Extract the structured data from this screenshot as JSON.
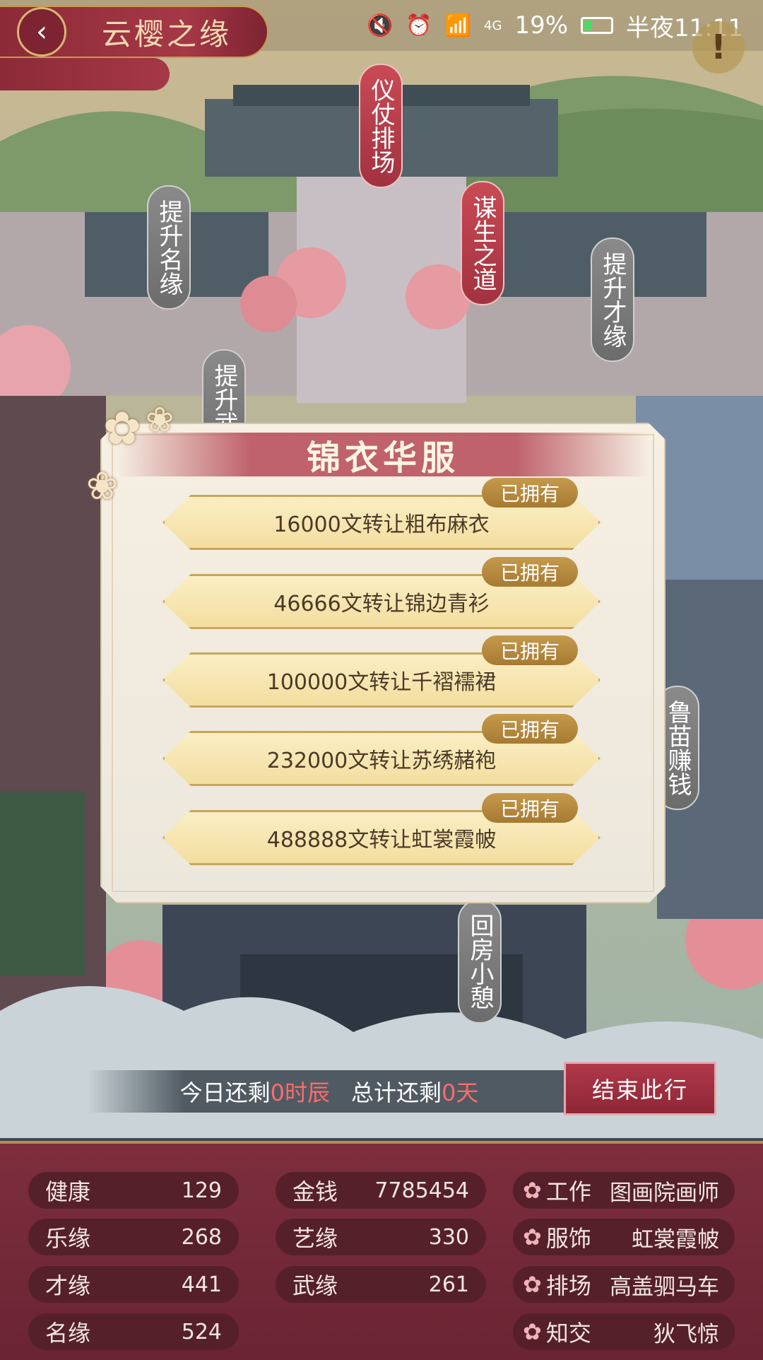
{
  "status_bar": {
    "battery": "19%",
    "time": "半夜11:11",
    "network": "4G"
  },
  "header": {
    "title": "云樱之缘"
  },
  "map_labels": [
    "仪仗排场",
    "谋生之道",
    "提升名缘",
    "提升才缘",
    "提升武缘",
    "鲁苗赚钱",
    "回房小憩"
  ],
  "popup": {
    "title": "锦衣华服",
    "owned_label": "已拥有",
    "options": [
      "16000文转让粗布麻衣",
      "46666文转让锦边青衫",
      "100000文转让千褶襦裙",
      "232000文转让苏绣赭袍",
      "488888文转让虹裳霞帔"
    ]
  },
  "timebar": {
    "today_prefix": "今日还剩",
    "today_value": "0时辰",
    "total_prefix": "总计还剩",
    "total_value": "0天"
  },
  "end_button": "结束此行",
  "stats": {
    "col1": [
      {
        "label": "健康",
        "value": "129"
      },
      {
        "label": "乐缘",
        "value": "268"
      },
      {
        "label": "才缘",
        "value": "441"
      },
      {
        "label": "名缘",
        "value": "524"
      }
    ],
    "col2": [
      {
        "label": "金钱",
        "value": "7785454"
      },
      {
        "label": "艺缘",
        "value": "330"
      },
      {
        "label": "武缘",
        "value": "261"
      }
    ],
    "col3": [
      {
        "label": "工作",
        "value": "图画院画师"
      },
      {
        "label": "服饰",
        "value": "虹裳霞帔"
      },
      {
        "label": "排场",
        "value": "高盖驷马车"
      },
      {
        "label": "知交",
        "value": "狄飞惊"
      }
    ]
  },
  "colors": {
    "accent_red": "#a53846",
    "gold": "#c59a4c",
    "panel": "#7d2e3d"
  }
}
